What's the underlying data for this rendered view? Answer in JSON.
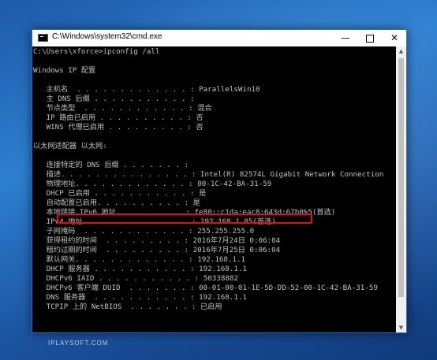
{
  "window": {
    "title": "C:\\Windows\\system32\\cmd.exe",
    "minimize_glyph": "—",
    "close_glyph": "✕",
    "icon": "cmd-icon"
  },
  "console_lines": [
    "C:\\Users\\xforce>ipconfig /all",
    "",
    "Windows IP 配置",
    "",
    "   主机名  . . . . . . . . . . . . . : ParallelsWin10",
    "   主 DNS 后缀 . . . . . . . . . . . :",
    "   节点类型  . . . . . . . . . . . . : 混合",
    "   IP 路由已启用 . . . . . . . . . . : 否",
    "   WINS 代理已启用 . . . . . . . . . : 否",
    "",
    "以太网适配器 以太网:",
    "",
    "   连接特定的 DNS 后缀 . . . . . . . :",
    "   描述. . . . . . . . . . . . . . . : Intel(R) 82574L Gigabit Network Connection",
    "   物理地址. . . . . . . . . . . . . : 00-1C-42-BA-31-59",
    "   DHCP 已启用 . . . . . . . . . . . : 是",
    "   自动配置已启用. . . . . . . . . . : 是",
    "   本地链接 IPv6 地址. . . . . . . . : fe80::c1da:eac8:643d:67b0%5(首选)",
    "   IPv4 地址 . . . . . . . . . . . . : 192.168.1.85(首选)",
    "   子网掩码  . . . . . . . . . . . . : 255.255.255.0",
    "   获得租约的时间  . . . . . . . . . : 2016年7月24日 0:06:04",
    "   租约过期的时间  . . . . . . . . . : 2016年7月25日 0:06:04",
    "   默认网关. . . . . . . . . . . . . : 192.168.1.1",
    "   DHCP 服务器 . . . . . . . . . . . : 192.168.1.1",
    "   DHCPv6 IAID . . . . . . . . . . . : 50338882",
    "   DHCPv6 客户端 DUID  . . . . . . . : 00-01-00-01-1E-5D-DD-52-00-1C-42-BA-31-59",
    "   DNS 服务器  . . . . . . . . . . . : 192.168.1.1",
    "   TCPIP 上的 NetBIOS  . . . . . . . : 已启用"
  ],
  "colors": {
    "console_bg": "#000000",
    "console_text": "#c0c0c0",
    "highlight_box": "#e01010"
  },
  "watermark": "IPLAYSOFT.COM"
}
